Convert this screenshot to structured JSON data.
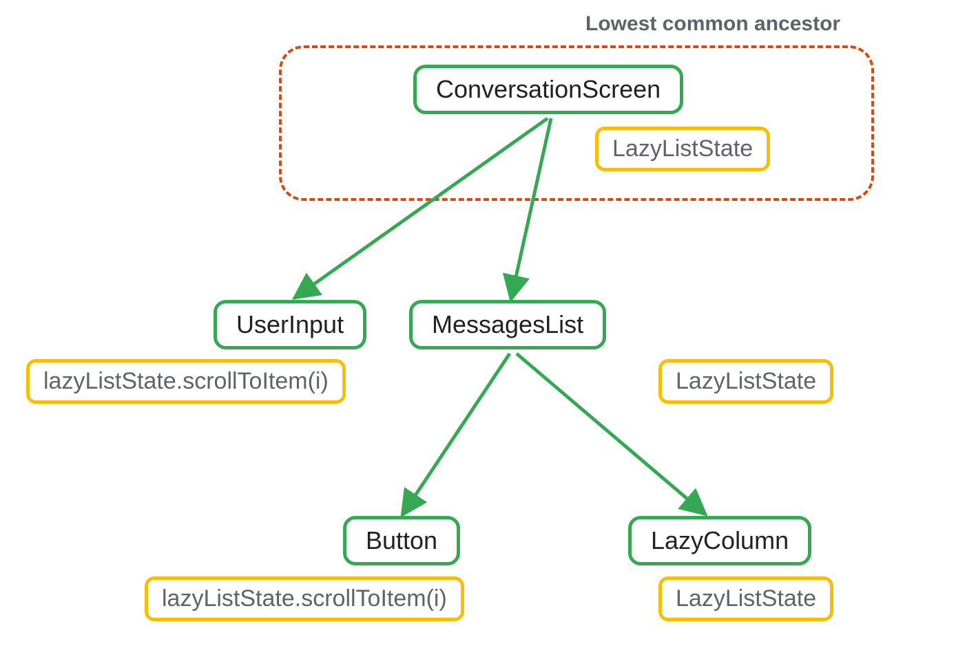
{
  "diagram": {
    "ancestorLabel": "Lowest common ancestor",
    "nodes": {
      "conversationScreen": "ConversationScreen",
      "lazyListState1": "LazyListState",
      "userInput": "UserInput",
      "userInputState": "lazyListState.scrollToItem(i)",
      "messagesList": "MessagesList",
      "messagesListState": "LazyListState",
      "button": "Button",
      "buttonState": "lazyListState.scrollToItem(i)",
      "lazyColumn": "LazyColumn",
      "lazyColumnState": "LazyListState"
    },
    "colors": {
      "greenBorder": "#34a853",
      "yellowBorder": "#fbbc04",
      "dashedBorder": "#d9480f",
      "nodeText": "#202124",
      "stateText": "#5f6368"
    }
  }
}
